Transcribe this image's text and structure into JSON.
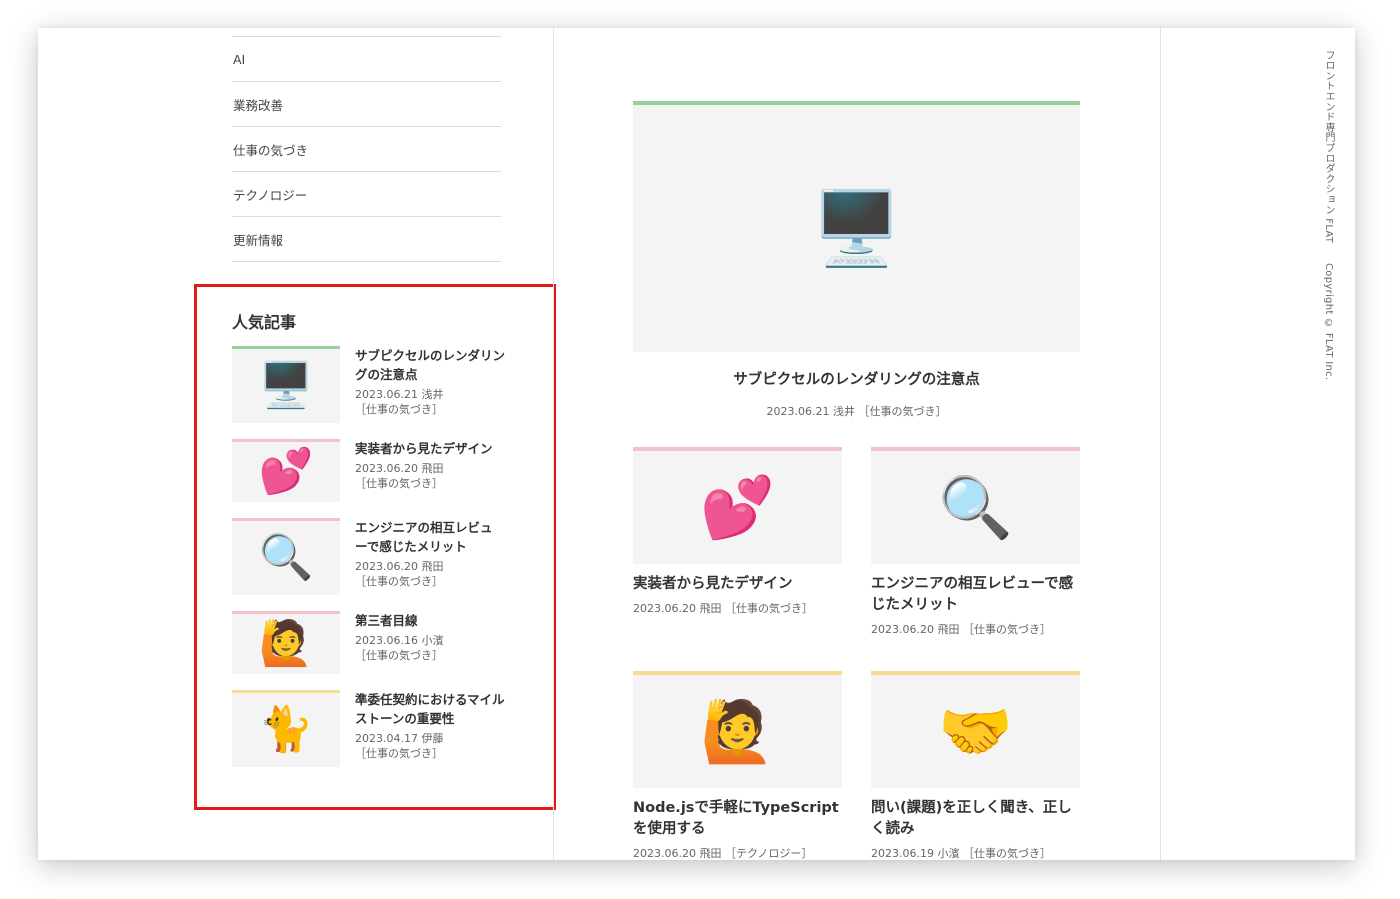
{
  "categories": [
    {
      "label": "AI"
    },
    {
      "label": "業務改善"
    },
    {
      "label": "仕事の気づき"
    },
    {
      "label": "テクノロジー"
    },
    {
      "label": "更新情報"
    }
  ],
  "popular": {
    "title": "人気記事",
    "items": [
      {
        "title": "サブピクセルのレンダリングの注意点",
        "date": "2023.06.21",
        "author": "浅井",
        "category": "［仕事の気づき］",
        "icon": "desktop-computer-icon",
        "emoji": "🖥️",
        "color": "#98d19a"
      },
      {
        "title": "実装者から見たデザイン",
        "date": "2023.06.20",
        "author": "飛田",
        "category": "［仕事の気づき］",
        "icon": "two-hearts-icon",
        "emoji": "💕",
        "color": "#f3c1c8"
      },
      {
        "title": "エンジニアの相互レビューで感じたメリット",
        "date": "2023.06.20",
        "author": "飛田",
        "category": "［仕事の気づき］",
        "icon": "magnifying-glass-icon",
        "emoji": "🔍",
        "color": "#f3c1c8"
      },
      {
        "title": "第三者目線",
        "date": "2023.06.16",
        "author": "小濱",
        "category": "［仕事の気づき］",
        "icon": "raising-hand-icon",
        "emoji": "🙋",
        "color": "#f3c1c8"
      },
      {
        "title": "準委任契約におけるマイルストーンの重要性",
        "date": "2023.04.17",
        "author": "伊藤",
        "category": "［仕事の気づき］",
        "icon": "cat-icon",
        "emoji": "🐈",
        "color": "#f6dc8e"
      }
    ]
  },
  "featured": {
    "title": "サブピクセルのレンダリングの注意点",
    "meta": "2023.06.21 浅井 ［仕事の気づき］",
    "icon": "desktop-computer-icon",
    "emoji": "🖥️",
    "color": "#98d19a"
  },
  "cards": [
    {
      "title": "実装者から見たデザイン",
      "meta": "2023.06.20 飛田 ［仕事の気づき］",
      "icon": "two-hearts-icon",
      "emoji": "💕",
      "color": "#f3c1c8"
    },
    {
      "title": "エンジニアの相互レビューで感じたメリット",
      "meta": "2023.06.20 飛田 ［仕事の気づき］",
      "icon": "magnifying-glass-icon",
      "emoji": "🔍",
      "color": "#f3c1c8"
    },
    {
      "title": "Node.jsで手軽にTypeScriptを使用する",
      "meta": "2023.06.20 飛田 ［テクノロジー］",
      "icon": "raising-hand-icon",
      "emoji": "🙋",
      "color": "#f6dc8e"
    },
    {
      "title": "問い(課題)を正しく聞き、正しく読み",
      "meta": "2023.06.19 小濱 ［仕事の気づき］",
      "icon": "handshake-icon",
      "emoji": "🤝",
      "color": "#f6dc8e"
    }
  ],
  "footer": {
    "company": "フロントエンド専門プロダクション FLAT",
    "copyright": "Copyright © FLAT Inc."
  }
}
